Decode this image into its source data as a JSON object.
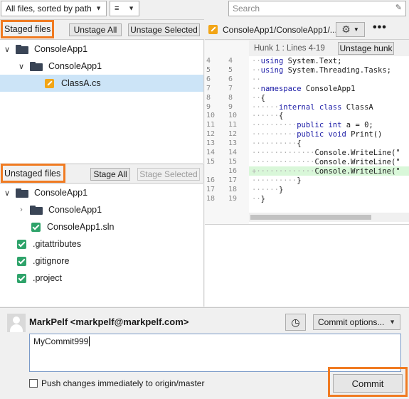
{
  "toolbar": {
    "files_filter": "All files, sorted by path",
    "search_placeholder": "Search"
  },
  "staged": {
    "title": "Staged files",
    "unstage_all": "Unstage All",
    "unstage_selected": "Unstage Selected",
    "tree": [
      {
        "label": "ConsoleApp1",
        "type": "folder",
        "level": 0
      },
      {
        "label": "ConsoleApp1",
        "type": "folder",
        "level": 1
      },
      {
        "label": "ClassA.cs",
        "type": "modified",
        "level": 2,
        "selected": true
      }
    ]
  },
  "unstaged": {
    "title": "Unstaged files",
    "stage_all": "Stage All",
    "stage_selected": "Stage Selected",
    "tree": [
      {
        "label": "ConsoleApp1",
        "type": "folder",
        "level": 0
      },
      {
        "label": "ConsoleApp1",
        "type": "folder-collapsed",
        "level": 1
      },
      {
        "label": "ConsoleApp1.sln",
        "type": "checked",
        "level": 1
      },
      {
        "label": ".gitattributes",
        "type": "checked",
        "level": 0
      },
      {
        "label": ".gitignore",
        "type": "checked",
        "level": 0
      },
      {
        "label": ".project",
        "type": "checked",
        "level": 0
      }
    ]
  },
  "diff": {
    "file_path": "ConsoleApp1/ConsoleApp1/...",
    "hunk_label": "Hunk 1 : Lines 4-19",
    "unstage_hunk": "Unstage hunk",
    "lines": [
      {
        "old": "4",
        "new": "4",
        "text": "using System.Text;",
        "added": false
      },
      {
        "old": "5",
        "new": "5",
        "text": "using System.Threading.Tasks;",
        "added": false
      },
      {
        "old": "6",
        "new": "6",
        "text": "",
        "added": false
      },
      {
        "old": "7",
        "new": "7",
        "text": "namespace ConsoleApp1",
        "added": false
      },
      {
        "old": "8",
        "new": "8",
        "text": "{",
        "added": false
      },
      {
        "old": "9",
        "new": "9",
        "text": "    internal class ClassA",
        "added": false
      },
      {
        "old": "10",
        "new": "10",
        "text": "    {",
        "added": false
      },
      {
        "old": "11",
        "new": "11",
        "text": "        public int a = 0;",
        "added": false
      },
      {
        "old": "12",
        "new": "12",
        "text": "        public void Print()",
        "added": false
      },
      {
        "old": "13",
        "new": "13",
        "text": "        {",
        "added": false
      },
      {
        "old": "14",
        "new": "14",
        "text": "            Console.WriteLine(\"",
        "added": false
      },
      {
        "old": "15",
        "new": "15",
        "text": "            Console.WriteLine(\"",
        "added": false
      },
      {
        "old": "",
        "new": "16",
        "text": "            Console.WriteLine(\"",
        "added": true
      },
      {
        "old": "16",
        "new": "17",
        "text": "        }",
        "added": false
      },
      {
        "old": "17",
        "new": "18",
        "text": "    }",
        "added": false
      },
      {
        "old": "18",
        "new": "19",
        "text": "}",
        "added": false
      }
    ]
  },
  "commit": {
    "author": "MarkPelf <markpelf@markpelf.com>",
    "message": "MyCommit999",
    "options_label": "Commit options...",
    "push_label": "Push changes immediately to origin/master",
    "commit_label": "Commit"
  },
  "colors": {
    "highlight": "#f07b22",
    "selected_row": "#cce4f7",
    "added_line": "#d9f7d9"
  }
}
